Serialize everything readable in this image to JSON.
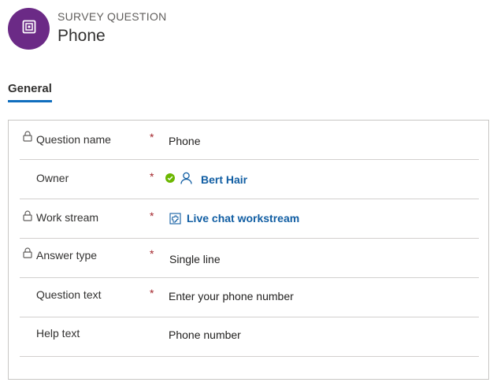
{
  "header": {
    "entity_type": "SURVEY QUESTION",
    "title": "Phone",
    "avatar_icon": "survey-question-icon",
    "avatar_color": "#6b2a86"
  },
  "tabs": [
    {
      "label": "General",
      "selected": true
    }
  ],
  "fields": [
    {
      "label": "Question name",
      "locked": true,
      "required": true,
      "value": "Phone"
    },
    {
      "label": "Owner",
      "locked": false,
      "required": true,
      "value": "Bert Hair",
      "icons": [
        "presence-available-icon",
        "person-icon"
      ]
    },
    {
      "label": "Work stream",
      "locked": true,
      "required": true,
      "value": "Live chat workstream",
      "icons": [
        "workstream-icon"
      ]
    },
    {
      "label": "Answer type",
      "locked": true,
      "required": true,
      "value": "Single line"
    },
    {
      "label": "Question text",
      "locked": false,
      "required": true,
      "value": "Enter your phone number"
    },
    {
      "label": "Help text",
      "locked": false,
      "required": false,
      "value": "Phone number"
    }
  ],
  "required_marker": "*",
  "colors": {
    "accent": "#106ebe",
    "link": "#115ea3",
    "required": "#a4262c",
    "presence": "#6bb700"
  }
}
